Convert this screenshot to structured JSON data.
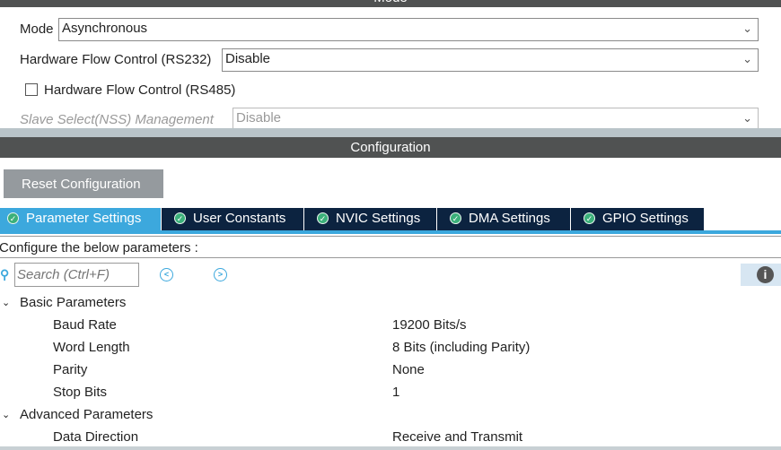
{
  "mode_section": {
    "title": "Mode",
    "mode": {
      "label": "Mode",
      "value": "Asynchronous"
    },
    "hw_flow_rs232": {
      "label": "Hardware Flow Control (RS232)",
      "value": "Disable"
    },
    "hw_flow_rs485": {
      "label": "Hardware Flow Control (RS485)",
      "checked": false
    },
    "nss": {
      "label": "Slave Select(NSS) Management",
      "value": "Disable"
    }
  },
  "config_section": {
    "title": "Configuration",
    "reset_label": "Reset Configuration",
    "tabs": [
      {
        "label": "Parameter Settings",
        "active": true
      },
      {
        "label": "User Constants"
      },
      {
        "label": "NVIC Settings"
      },
      {
        "label": "DMA Settings"
      },
      {
        "label": "GPIO Settings"
      }
    ],
    "instruction": "Configure the below parameters :",
    "search_placeholder": "Search (Ctrl+F)",
    "groups": [
      {
        "name": "Basic Parameters",
        "params": [
          {
            "name": "Baud Rate",
            "value": "19200 Bits/s"
          },
          {
            "name": "Word Length",
            "value": "8 Bits (including Parity)"
          },
          {
            "name": "Parity",
            "value": "None"
          },
          {
            "name": "Stop Bits",
            "value": "1"
          }
        ]
      },
      {
        "name": "Advanced Parameters",
        "params": [
          {
            "name": "Data Direction",
            "value": "Receive and Transmit"
          }
        ]
      }
    ]
  },
  "colors": {
    "header": "#505252",
    "tab": "#0c2340",
    "tab_active": "#3ca8dd"
  }
}
